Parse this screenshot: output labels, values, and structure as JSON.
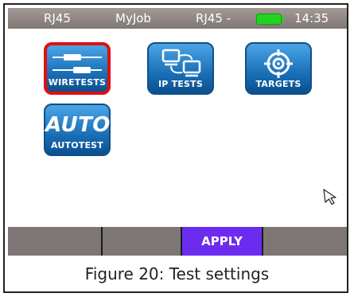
{
  "status_bar": {
    "left": "RJ45",
    "job": "MyJob",
    "port_status": "RJ45 -",
    "time": "14:35",
    "battery_icon": "battery-icon"
  },
  "tiles": [
    {
      "label": "WIRETESTS",
      "icon": "wiretests-icon",
      "selected": true
    },
    {
      "label": "IP TESTS",
      "icon": "ip-tests-icon",
      "selected": false
    },
    {
      "label": "TARGETS",
      "icon": "targets-icon",
      "selected": false
    },
    {
      "label": "AUTOTEST",
      "icon_text": "AUTO",
      "icon": "autotest-icon",
      "selected": false
    }
  ],
  "softkeys": [
    "",
    "",
    "APPLY",
    ""
  ],
  "caption": "Figure 20: Test settings",
  "colors": {
    "selection_border": "#e01010",
    "active_softkey": "#6c2cf0",
    "battery": "#22d41e"
  }
}
